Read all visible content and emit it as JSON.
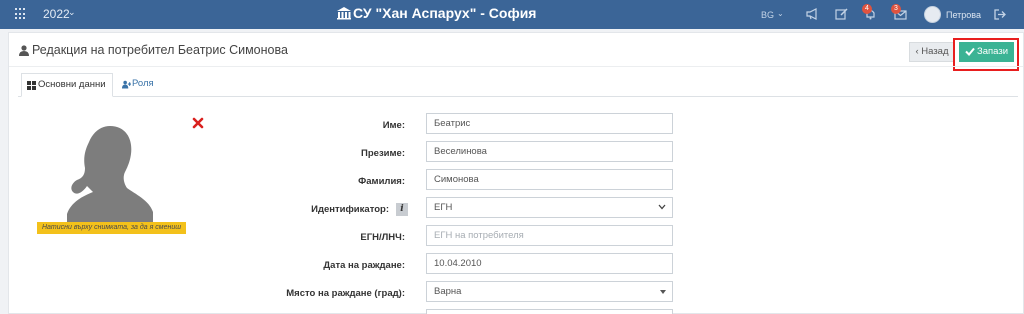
{
  "topbar": {
    "year": "2022",
    "school_name": "СУ \"Хан Аспарух\" - София",
    "language": "BG",
    "notifications_count": "4",
    "messages_count": "3",
    "username": "Петрова",
    "icons": [
      "apps-grid-icon",
      "school-icon",
      "megaphone-icon",
      "edit-icon",
      "bell-icon",
      "mail-icon",
      "logout-icon"
    ]
  },
  "page": {
    "title": "Редакция на потребител Беатрис Симонова",
    "back_label": "Назад",
    "save_label": "Запази"
  },
  "tabs": [
    {
      "label": "Основни данни",
      "icon": "th-large-icon",
      "active": true
    },
    {
      "label": "Роля",
      "icon": "user-plus-icon",
      "active": false
    }
  ],
  "photo": {
    "hint": "Натисни върху снимката, за да я смениш"
  },
  "form": {
    "first_name_label": "Име:",
    "first_name": "Беатрис",
    "middle_name_label": "Презиме:",
    "middle_name": "Веселинова",
    "last_name_label": "Фамилия:",
    "last_name": "Симонова",
    "identifier_label": "Идентификатор:",
    "identifier": "ЕГН",
    "egn_label": "ЕГН/ЛНЧ:",
    "egn_placeholder": "ЕГН на потребителя",
    "birth_date_label": "Дата на раждане:",
    "birth_date": "10.04.2010",
    "birth_place_label": "Място на раждане (град):",
    "birth_place": "Варна"
  },
  "colors": {
    "topbar": "#3b6597",
    "save_button": "#3bb394",
    "highlight_frame": "#e81e1e",
    "hint_bg": "#f3c11b",
    "badge": "#e0533f"
  }
}
